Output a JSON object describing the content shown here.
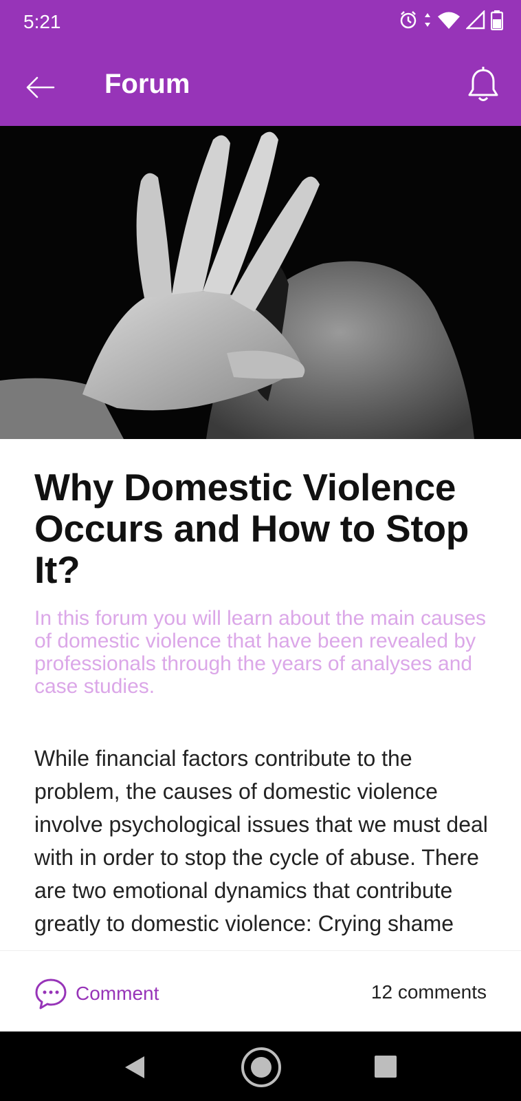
{
  "status_bar": {
    "time": "5:21",
    "icons": [
      "alarm-icon",
      "data-arrows-icon",
      "wifi-icon",
      "signal-icon",
      "battery-icon"
    ]
  },
  "app_bar": {
    "title": "Forum",
    "back_icon": "arrow-left-icon",
    "notification_icon": "bell-icon"
  },
  "post": {
    "image_alt": "black and white photo of a woman covering her face with an open hand",
    "title": "Why Domestic Violence Occurs and How to Stop It?",
    "subtitle": "In this forum you will learn about the main causes of domestic violence that have been revealed by professionals through the years of analyses and case studies.",
    "body": "While financial factors contribute to the problem, the causes of domestic violence involve psychological issues that we must deal with in order to stop the cycle of abuse. There are two emotional dynamics that contribute greatly to domestic violence: Crying shame and attention"
  },
  "comment_bar": {
    "comment_label": "Comment",
    "comment_count": "12 comments",
    "comment_icon": "chat-bubble-icon"
  },
  "colors": {
    "primary": "#9734b8",
    "subtitle": "#dba7e8",
    "text": "#222222"
  },
  "nav_bar": {
    "buttons": [
      "back-triangle-icon",
      "home-circle-icon",
      "recents-square-icon"
    ]
  }
}
